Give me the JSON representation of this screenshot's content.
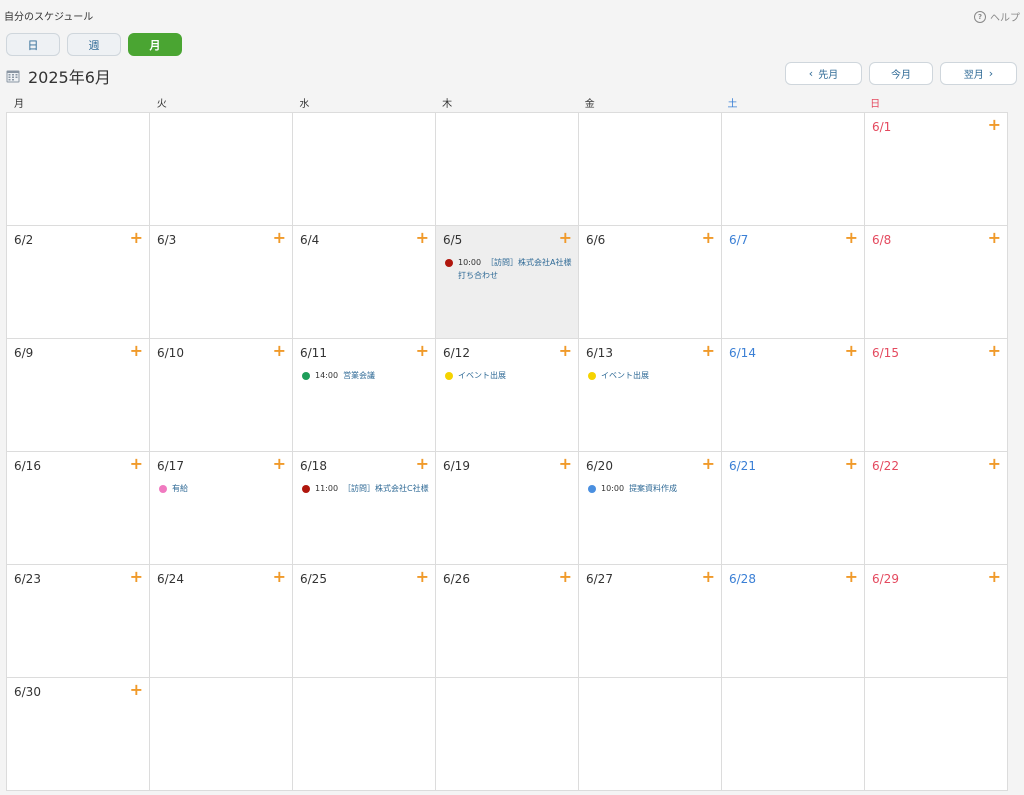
{
  "header": {
    "page_title": "自分のスケジュール",
    "help_label": "ヘルプ"
  },
  "view_tabs": [
    {
      "label": "日",
      "active": false
    },
    {
      "label": "週",
      "active": false
    },
    {
      "label": "月",
      "active": true
    }
  ],
  "month_title": "2025年6月",
  "nav": {
    "prev": "先月",
    "today": "今月",
    "next": "翌月"
  },
  "colors": {
    "accent": "#4aa532",
    "add": "#f09a2a",
    "saturday": "#3a7fd5",
    "sunday": "#e4495e",
    "link": "#2f6a96"
  },
  "weekdays": [
    "月",
    "火",
    "水",
    "木",
    "金",
    "土",
    "日"
  ],
  "calendar": {
    "weeks": [
      [
        {
          "date": ""
        },
        {
          "date": ""
        },
        {
          "date": ""
        },
        {
          "date": ""
        },
        {
          "date": ""
        },
        {
          "date": ""
        },
        {
          "date": "6/1",
          "events": []
        }
      ],
      [
        {
          "date": "6/2",
          "events": []
        },
        {
          "date": "6/3",
          "events": []
        },
        {
          "date": "6/4",
          "events": []
        },
        {
          "date": "6/5",
          "highlight": true,
          "events": [
            {
              "time": "10:00",
              "title": "［訪問］株式会社A社様  打ち合わせ",
              "color": "#b0160d"
            }
          ]
        },
        {
          "date": "6/6",
          "events": []
        },
        {
          "date": "6/7",
          "events": []
        },
        {
          "date": "6/8",
          "events": []
        }
      ],
      [
        {
          "date": "6/9",
          "events": []
        },
        {
          "date": "6/10",
          "events": []
        },
        {
          "date": "6/11",
          "events": [
            {
              "time": "14:00",
              "title": "営業会議",
              "color": "#1e9e5a"
            }
          ]
        },
        {
          "date": "6/12",
          "events": [
            {
              "time": "",
              "title": "イベント出展",
              "color": "#f5d300"
            }
          ]
        },
        {
          "date": "6/13",
          "events": [
            {
              "time": "",
              "title": "イベント出展",
              "color": "#f5d300"
            }
          ]
        },
        {
          "date": "6/14",
          "events": []
        },
        {
          "date": "6/15",
          "events": []
        }
      ],
      [
        {
          "date": "6/16",
          "events": []
        },
        {
          "date": "6/17",
          "events": [
            {
              "time": "",
              "title": "有給",
              "color": "#f07ac0"
            }
          ]
        },
        {
          "date": "6/18",
          "events": [
            {
              "time": "11:00",
              "title": "［訪問］株式会社C社様",
              "color": "#b0160d"
            }
          ]
        },
        {
          "date": "6/19",
          "events": []
        },
        {
          "date": "6/20",
          "events": [
            {
              "time": "10:00",
              "title": "提案資料作成",
              "color": "#4a8fe0"
            }
          ]
        },
        {
          "date": "6/21",
          "events": []
        },
        {
          "date": "6/22",
          "events": []
        }
      ],
      [
        {
          "date": "6/23",
          "events": []
        },
        {
          "date": "6/24",
          "events": []
        },
        {
          "date": "6/25",
          "events": []
        },
        {
          "date": "6/26",
          "events": []
        },
        {
          "date": "6/27",
          "events": []
        },
        {
          "date": "6/28",
          "events": []
        },
        {
          "date": "6/29",
          "events": []
        }
      ],
      [
        {
          "date": "6/30",
          "events": []
        },
        {
          "date": ""
        },
        {
          "date": ""
        },
        {
          "date": ""
        },
        {
          "date": ""
        },
        {
          "date": ""
        },
        {
          "date": ""
        }
      ]
    ]
  }
}
